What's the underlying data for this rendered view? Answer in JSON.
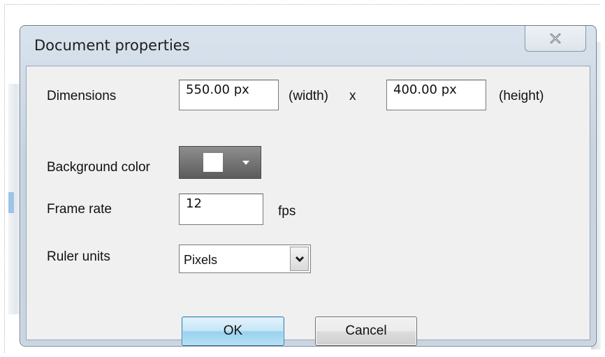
{
  "dialog": {
    "title": "Document properties",
    "close_symbol": "close-icon"
  },
  "dimensions": {
    "label": "Dimensions",
    "width_value": "550.00 px",
    "width_caption": "(width)",
    "separator": "x",
    "height_value": "400.00 px",
    "height_caption": "(height)"
  },
  "background": {
    "label": "Background color",
    "color": "#ffffff"
  },
  "frame_rate": {
    "label": "Frame rate",
    "value": "12",
    "unit": "fps"
  },
  "ruler": {
    "label": "Ruler units",
    "selected": "Pixels"
  },
  "buttons": {
    "ok": "OK",
    "cancel": "Cancel"
  },
  "colors": {
    "ok_button_accent": "#98d1ef",
    "window_frame": "#c9d5e2",
    "client_background": "#f0f0f0"
  }
}
